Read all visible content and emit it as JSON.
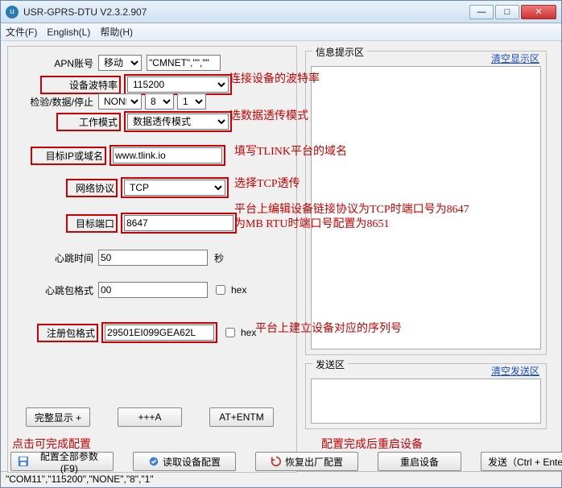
{
  "window": {
    "title": "USR-GPRS-DTU V2.3.2.907"
  },
  "menu": {
    "file": "文件(F)",
    "english": "English(L)",
    "help": "帮助(H)"
  },
  "left": {
    "apn_label": "APN账号",
    "apn_value": "移动",
    "apn_extra": "\"CMNET\",\"\",\"\"",
    "baud_label": "设备波特率",
    "baud_value": "115200",
    "check_label": "检验/数据/停止",
    "check_v1": "NONE",
    "check_v2": "8",
    "check_v3": "1",
    "mode_label": "工作模式",
    "mode_value": "数据透传模式",
    "ip_label": "目标IP或域名",
    "ip_value": "www.tlink.io",
    "proto_label": "网络协议",
    "proto_value": "TCP",
    "port_label": "目标端口",
    "port_value": "8647",
    "hb_time_label": "心跳时间",
    "hb_time_value": "50",
    "hb_time_unit": "秒",
    "hb_fmt_label": "心跳包格式",
    "hb_fmt_value": "00",
    "hex1": "hex",
    "reg_label": "注册包格式",
    "reg_value": "29501EI099GEA62L",
    "hex2": "hex",
    "btn_full": "完整显示 +",
    "btn_a": "+++A",
    "btn_at": "AT+ENTM"
  },
  "right": {
    "info_title": "信息提示区",
    "info_clear": "清空显示区",
    "send_title": "发送区",
    "send_clear": "清空发送区"
  },
  "bottom": {
    "btn_cfg_all": "配置全部参数(F9)",
    "btn_read": "读取设备配置",
    "btn_restore": "恢复出厂配置",
    "btn_reboot": "重启设备",
    "btn_send": "发送（Ctrl + Enter）"
  },
  "status": "\"COM11\",\"115200\",\"NONE\",\"8\",\"1\"",
  "annot": {
    "a1": "连接设备的波特率",
    "a2": "选数据透传模式",
    "a3": "填写TLINK平台的域名",
    "a4": "选择TCP透传",
    "a5a": "平台上编辑设备链接协议为TCP时端口号为8647",
    "a5b": "为MB RTU时端口号配置为8651",
    "a6": "平台上建立设备对应的序列号",
    "a7": "点击可完成配置",
    "a8": "配置完成后重启设备"
  }
}
